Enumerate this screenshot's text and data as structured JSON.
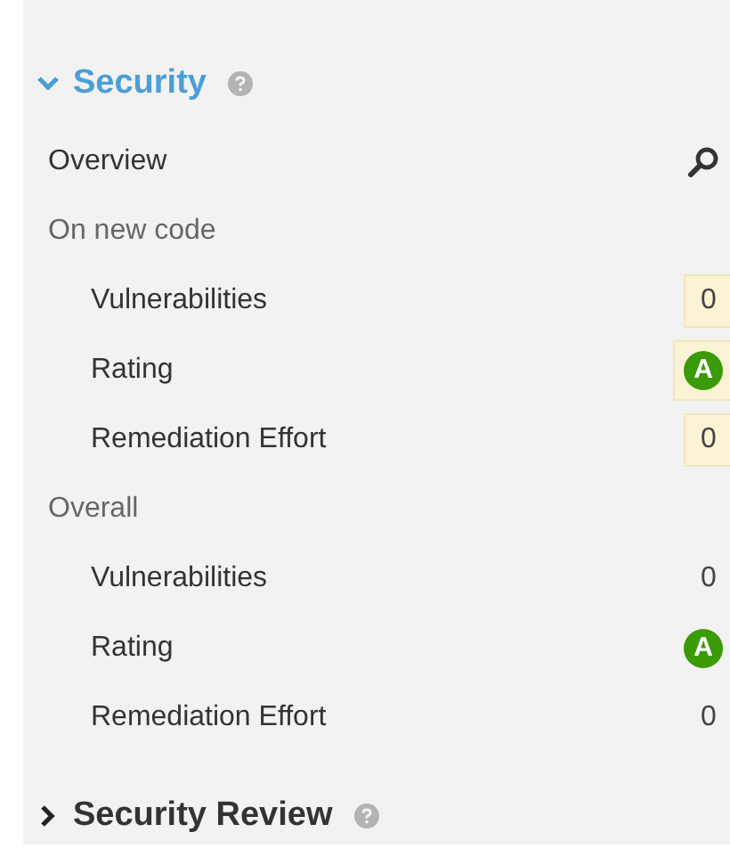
{
  "sections": [
    {
      "title": "Security",
      "expanded": true,
      "overview": {
        "label": "Overview"
      },
      "groups": [
        {
          "label": "On new code",
          "highlighted": true,
          "metrics": [
            {
              "kind": "value",
              "label": "Vulnerabilities",
              "value": "0"
            },
            {
              "kind": "rating",
              "label": "Rating",
              "value": "A"
            },
            {
              "kind": "value",
              "label": "Remediation Effort",
              "value": "0"
            }
          ]
        },
        {
          "label": "Overall",
          "highlighted": false,
          "metrics": [
            {
              "kind": "value",
              "label": "Vulnerabilities",
              "value": "0"
            },
            {
              "kind": "rating",
              "label": "Rating",
              "value": "A"
            },
            {
              "kind": "value",
              "label": "Remediation Effort",
              "value": "0"
            }
          ]
        }
      ]
    },
    {
      "title": "Security Review",
      "expanded": false
    }
  ]
}
